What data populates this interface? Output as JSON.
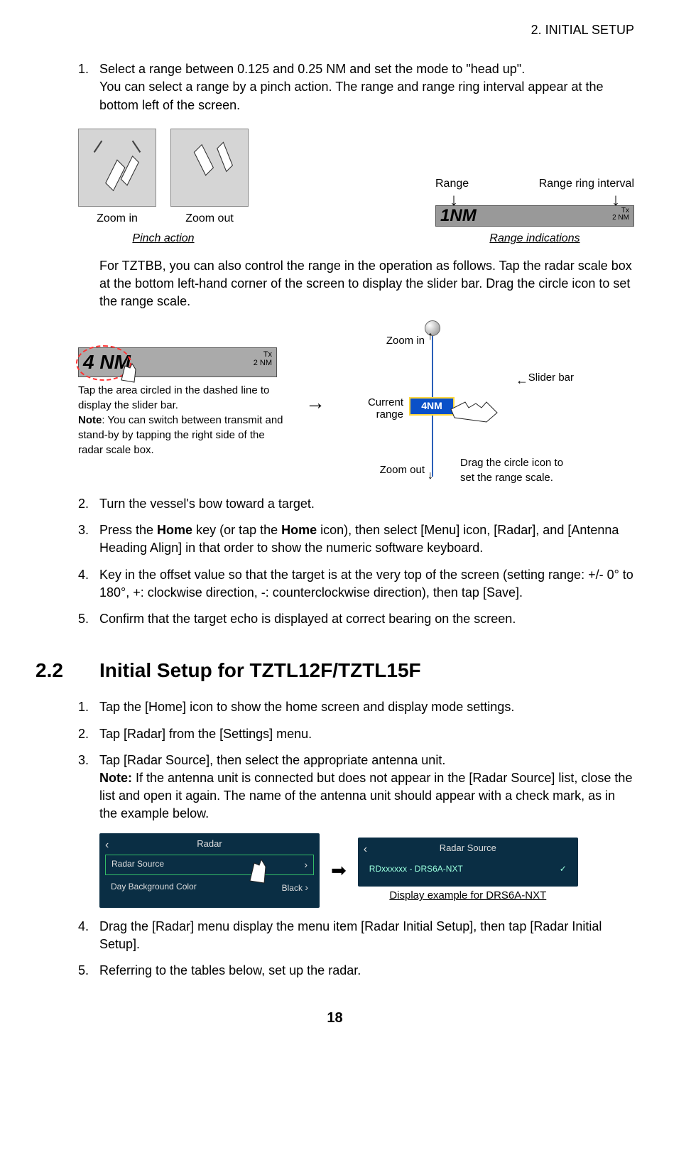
{
  "header": "2.  INITIAL SETUP",
  "list1": {
    "items": [
      {
        "num": "1.",
        "text_a": "Select a range between 0.125 and 0.25 NM and set the mode to \"head up\".",
        "text_b": "You can select a range by a pinch action. The range and range ring interval appear at the bottom left of the screen."
      },
      {
        "num": "2.",
        "text": "Turn the vessel's bow toward a target."
      },
      {
        "num": "3.",
        "text_a": "Press the ",
        "b1": "Home",
        "text_b": " key (or tap the ",
        "b2": "Home",
        "text_c": " icon), then select [Menu] icon, [Radar], and [Antenna Heading Align] in that order to show the numeric software keyboard."
      },
      {
        "num": "4.",
        "text": "Key in the offset value so that the target is at the very top of the screen (setting range: +/- 0° to 180°, +: clockwise direction, -: counterclockwise direction), then tap [Save]."
      },
      {
        "num": "5.",
        "text": "Confirm that the target echo is displayed at correct bearing on the screen."
      }
    ]
  },
  "pinch": {
    "zoom_in": "Zoom in",
    "zoom_out": "Zoom out",
    "caption": "Pinch action"
  },
  "rangefig": {
    "range": "Range",
    "ring": "Range ring interval",
    "value": "1",
    "unit": "NM",
    "tx": "Tx",
    "ring_val": "2 NM",
    "caption": "Range indications"
  },
  "para_tztbb": "For TZTBB, you can also control the range in the operation as follows. Tap the radar scale box at the bottom left-hand corner of the screen to display the slider bar. Drag the circle icon to set the range scale.",
  "tap": {
    "value": "4",
    "unit": "NM",
    "tx": "Tx",
    "ring_val": "2 NM",
    "note_a": "Tap the area circled in the dashed line to display the slider bar.",
    "note_b": "Note",
    "note_c": ": You can switch between transmit and stand-by by tapping the right side of the radar scale box."
  },
  "slider": {
    "zi": "Zoom in",
    "zo": "Zoom out",
    "current": "Current range",
    "box": "4NM",
    "sb": "Slider bar",
    "drag": "Drag the circle icon to set the range scale."
  },
  "section": {
    "num": "2.2",
    "title": "Initial Setup for TZTL12F/TZTL15F"
  },
  "list2": {
    "items": [
      {
        "num": "1.",
        "text": "Tap the [Home] icon to show the home screen and display mode settings."
      },
      {
        "num": "2.",
        "text": "Tap [Radar] from the [Settings] menu."
      },
      {
        "num": "3.",
        "text_a": "Tap [Radar Source], then select the appropriate antenna unit.",
        "note_b": "Note:",
        "text_b": " If the antenna unit is connected but does not appear in the [Radar Source] list, close the list and open it again. The name of the antenna unit should appear with a check mark, as in the example below."
      },
      {
        "num": "4.",
        "text": "Drag the [Radar] menu display the menu item [Radar Initial Setup], then tap [Radar Initial Setup]."
      },
      {
        "num": "5.",
        "text": "Referring to the tables below, set up the radar."
      }
    ]
  },
  "radarmenu": {
    "left_title": "Radar",
    "row1": "Radar Source",
    "row2": "Day Background Color",
    "row2v": "Black",
    "right_title": "Radar Source",
    "entry": "RDxxxxxx - DRS6A-NXT",
    "caption": "Display example for DRS6A-NXT"
  },
  "page_num": "18"
}
